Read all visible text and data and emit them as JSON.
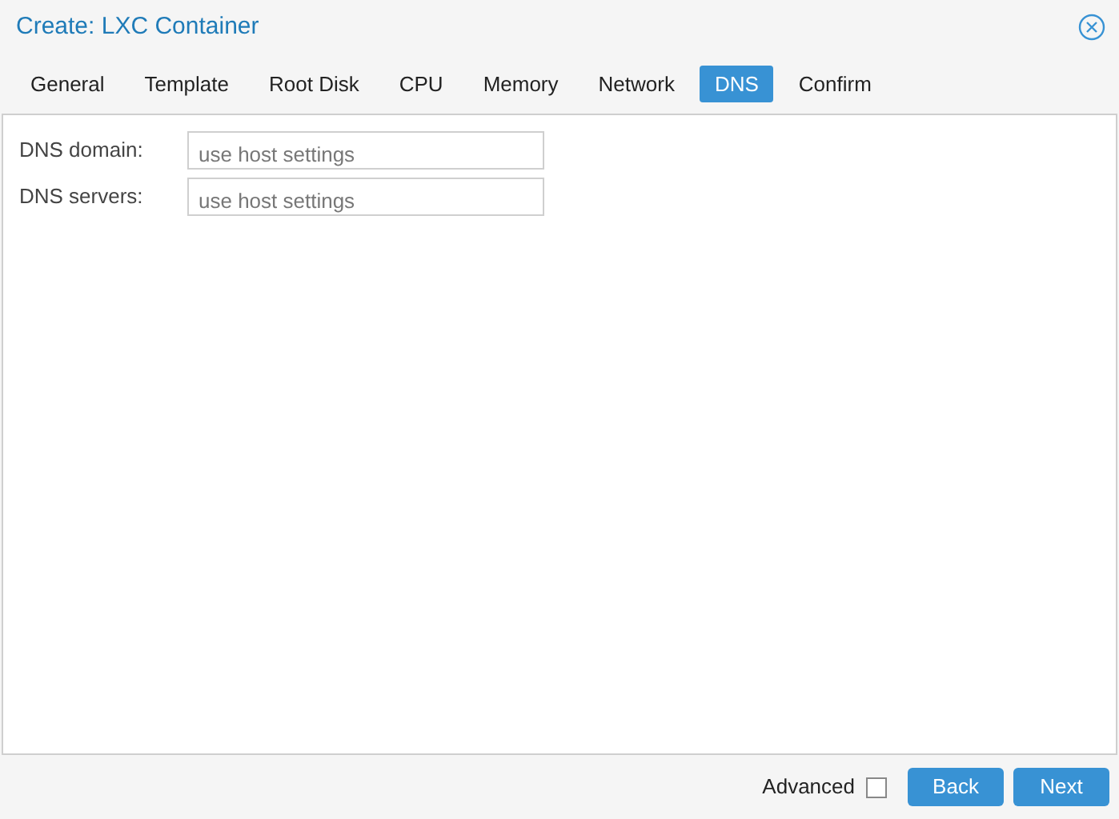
{
  "window": {
    "title": "Create: LXC Container"
  },
  "tabs": [
    {
      "label": "General",
      "selected": false
    },
    {
      "label": "Template",
      "selected": false
    },
    {
      "label": "Root Disk",
      "selected": false
    },
    {
      "label": "CPU",
      "selected": false
    },
    {
      "label": "Memory",
      "selected": false
    },
    {
      "label": "Network",
      "selected": false
    },
    {
      "label": "DNS",
      "selected": true
    },
    {
      "label": "Confirm",
      "selected": false
    }
  ],
  "fields": [
    {
      "label": "DNS domain:",
      "placeholder": "use host settings"
    },
    {
      "label": "DNS servers:",
      "placeholder": "use host settings"
    }
  ],
  "footer": {
    "advanced": {
      "label": "Advanced",
      "checked": false
    },
    "buttons": [
      "Back",
      "Next"
    ]
  }
}
